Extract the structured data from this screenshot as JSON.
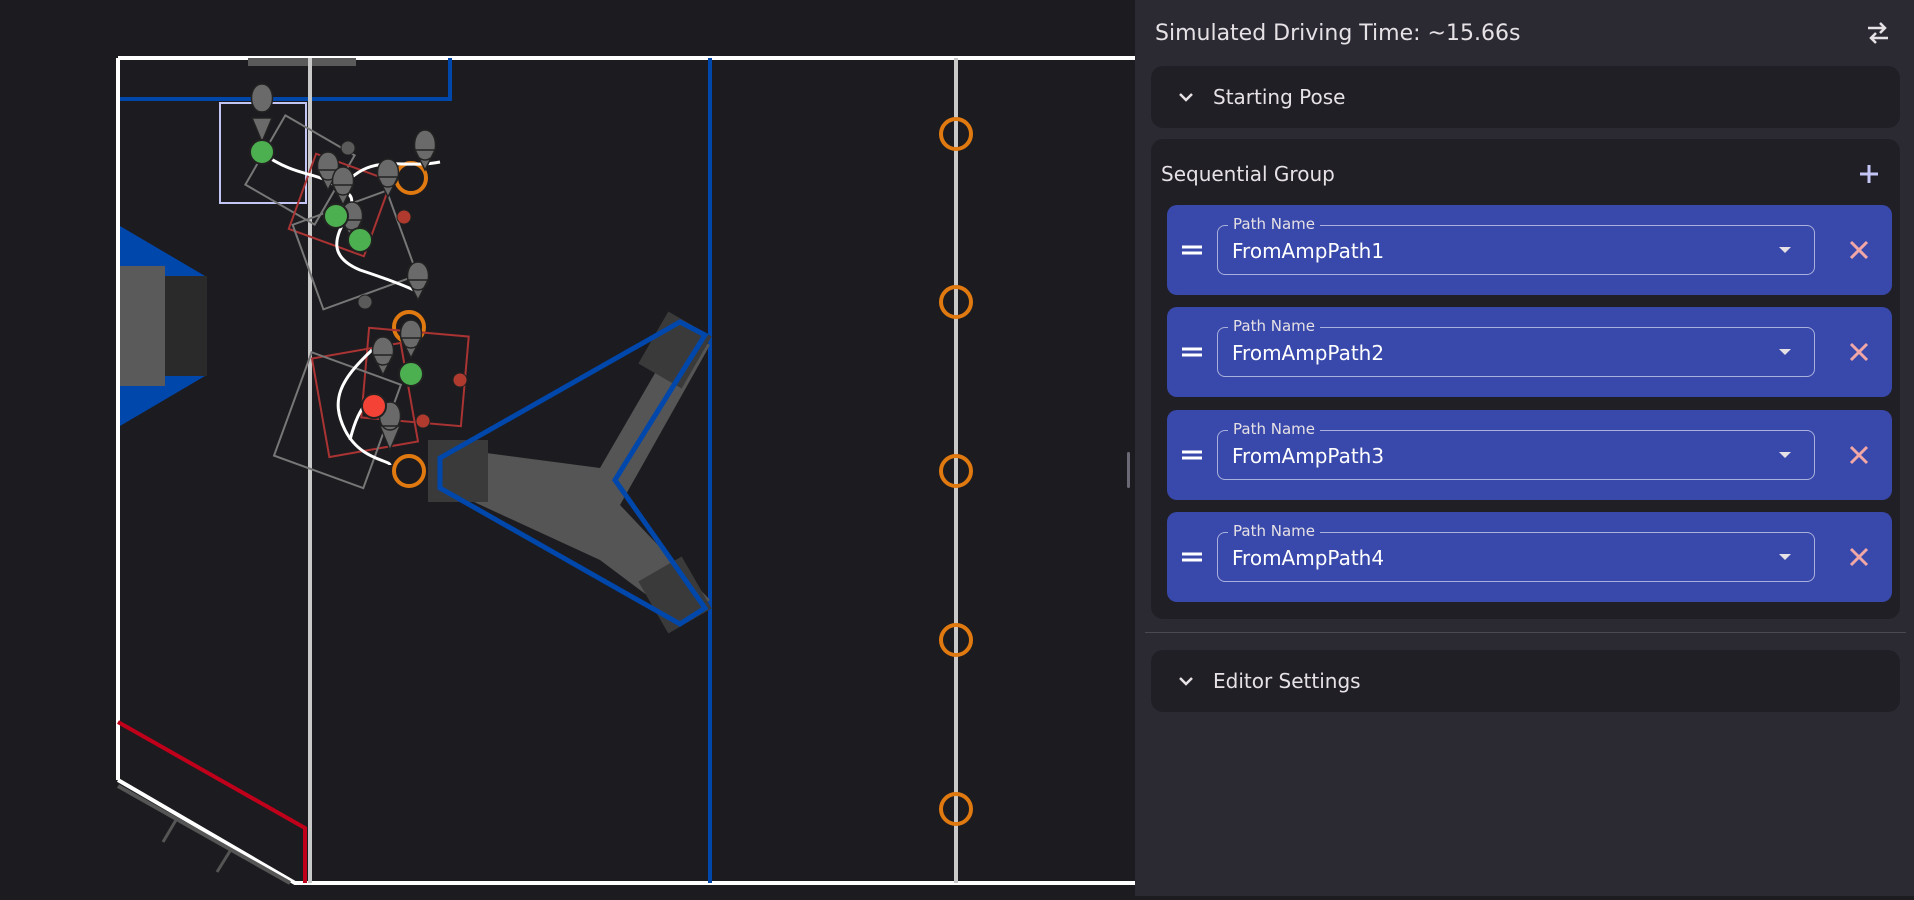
{
  "panel": {
    "title": "Simulated Driving Time: ~15.66s",
    "swap_icon": "swap-horiz-icon",
    "starting_pose_label": "Starting Pose",
    "group_title": "Sequential Group",
    "commands": [
      {
        "field_label": "Path Name",
        "value": "FromAmpPath1"
      },
      {
        "field_label": "Path Name",
        "value": "FromAmpPath2"
      },
      {
        "field_label": "Path Name",
        "value": "FromAmpPath3"
      },
      {
        "field_label": "Path Name",
        "value": "FromAmpPath4"
      }
    ],
    "editor_settings_label": "Editor Settings"
  },
  "colors": {
    "background": "#1c1b1f",
    "panel": "#2b2a33",
    "card": "#211f26",
    "command_card": "#3949ab",
    "delete_icon": "#f2a7a7",
    "add_icon": "#c3c6f4",
    "blue_alliance": "#0047ab",
    "red_alliance": "#c0001b",
    "note_ring": "#e07a10",
    "waypoint_green": "#4caf50",
    "waypoint_red": "#f44336"
  }
}
